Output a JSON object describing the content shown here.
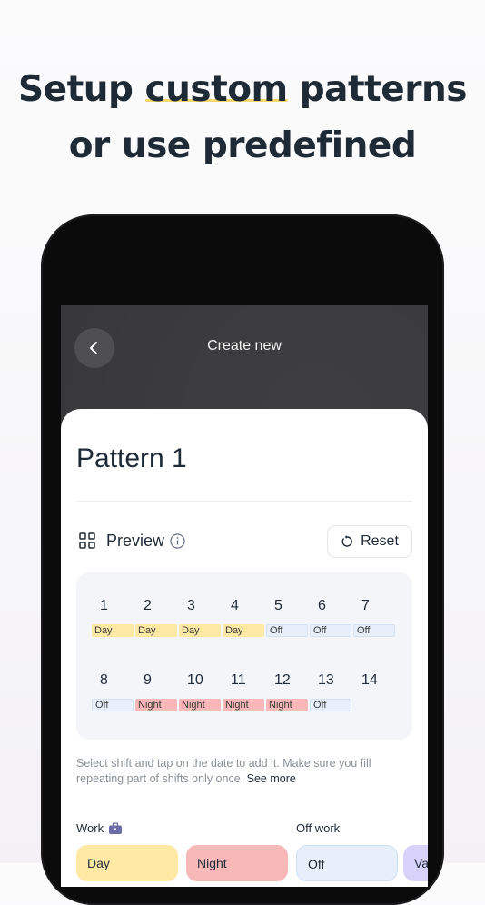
{
  "headline": {
    "line1_pre": "Setup ",
    "line1_highlight": "custom",
    "line1_post": " patterns",
    "line2": "or use predefined"
  },
  "nav": {
    "title": "Create new",
    "back_icon": "chevron-left-icon"
  },
  "pattern": {
    "name": "Pattern 1"
  },
  "preview": {
    "label": "Preview",
    "reset_label": "Reset"
  },
  "calendar": {
    "days": [
      {
        "num": "1",
        "shift": "Day",
        "kind": "day"
      },
      {
        "num": "2",
        "shift": "Day",
        "kind": "day"
      },
      {
        "num": "3",
        "shift": "Day",
        "kind": "day"
      },
      {
        "num": "4",
        "shift": "Day",
        "kind": "day"
      },
      {
        "num": "5",
        "shift": "Off",
        "kind": "off"
      },
      {
        "num": "6",
        "shift": "Off",
        "kind": "off"
      },
      {
        "num": "7",
        "shift": "Off",
        "kind": "off"
      },
      {
        "num": "8",
        "shift": "Off",
        "kind": "off"
      },
      {
        "num": "9",
        "shift": "Night",
        "kind": "night"
      },
      {
        "num": "10",
        "shift": "Night",
        "kind": "night"
      },
      {
        "num": "11",
        "shift": "Night",
        "kind": "night"
      },
      {
        "num": "12",
        "shift": "Night",
        "kind": "night"
      },
      {
        "num": "13",
        "shift": "Off",
        "kind": "off"
      },
      {
        "num": "14",
        "shift": "",
        "kind": "none"
      }
    ]
  },
  "hint": {
    "text": "Select shift and tap on the date to add it. Make sure you fill repeating part of shifts only once. ",
    "see_more": "See more"
  },
  "categories": {
    "work": "Work",
    "off_work": "Off work"
  },
  "chips": [
    {
      "label": "Day",
      "color": "#fde8a4"
    },
    {
      "label": "Night",
      "color": "#f8b8b8"
    },
    {
      "label": "Off",
      "color": "#e6effa"
    },
    {
      "label": "Va",
      "color": "#d9d2fb"
    }
  ],
  "colors": {
    "day": "#fde8a4",
    "night": "#f8b8b8",
    "off": "#e6effa",
    "highlight": "#f4d66a"
  }
}
